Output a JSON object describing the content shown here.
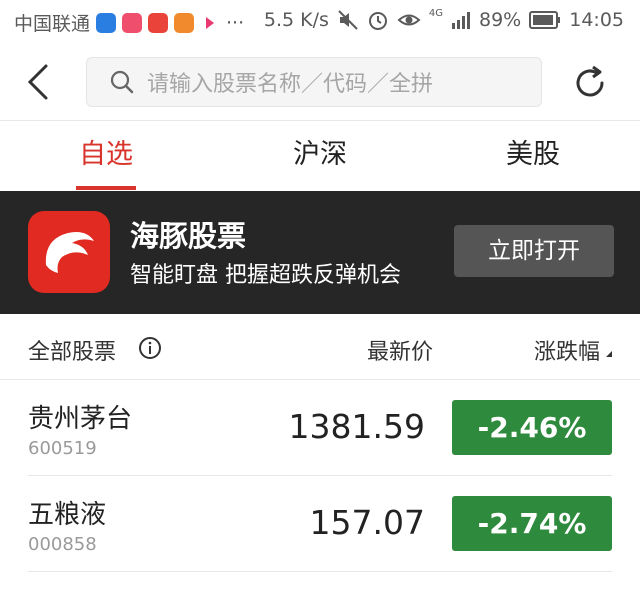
{
  "status_bar": {
    "carrier": "中国联通",
    "more": "···",
    "speed": "5.5 K/s",
    "network": "4G",
    "battery": "89%",
    "time": "14:05"
  },
  "search": {
    "placeholder": "请输入股票名称／代码／全拼"
  },
  "tabs": [
    {
      "label": "自选",
      "active": true
    },
    {
      "label": "沪深",
      "active": false
    },
    {
      "label": "美股",
      "active": false
    }
  ],
  "banner": {
    "title": "海豚股票",
    "subtitle": "智能盯盘 把握超跌反弹机会",
    "button": "立即打开"
  },
  "list_header": {
    "name": "全部股票",
    "price": "最新价",
    "change": "涨跌幅"
  },
  "stocks": [
    {
      "name": "贵州茅台",
      "code": "600519",
      "price": "1381.59",
      "change": "-2.46%"
    },
    {
      "name": "五粮液",
      "code": "000858",
      "price": "157.07",
      "change": "-2.74%"
    }
  ],
  "colors": {
    "accent": "#d9342b",
    "down": "#2e8a3c",
    "banner_bg": "#262626"
  }
}
